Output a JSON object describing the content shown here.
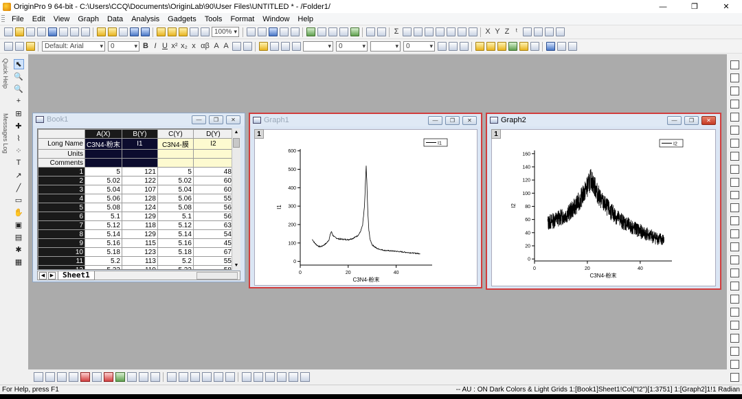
{
  "app": {
    "title": "OriginPro 9 64-bit - C:\\Users\\CCQ\\Documents\\OriginLab\\90\\User Files\\UNTITLED * - /Folder1/",
    "window_controls": {
      "minimize": "—",
      "restore": "❐",
      "close": "✕"
    }
  },
  "menu": [
    "File",
    "Edit",
    "View",
    "Graph",
    "Data",
    "Analysis",
    "Gadgets",
    "Tools",
    "Format",
    "Window",
    "Help"
  ],
  "toolbar": {
    "zoom": "100%",
    "font_name": "Default: Arial",
    "font_size": "0",
    "line_width": "0",
    "line_size2": "0",
    "format_glyphs": [
      "B",
      "I",
      "U",
      "x²",
      "x₂",
      "x",
      "αβ",
      "A",
      "A"
    ],
    "math_glyphs": [
      "Σ",
      "X",
      "Y",
      "Z",
      "ᵗ"
    ]
  },
  "side_tabs": {
    "quick_help": "Quick Help",
    "messages_log": "Messages Log"
  },
  "left_tools": [
    "⬉",
    "🔍",
    "🔍",
    "+",
    "⊞",
    "✚",
    "⌇",
    "⁘",
    "T",
    "↗",
    "╱",
    "▭",
    "✋",
    "▣",
    "▤",
    "✱",
    "▦"
  ],
  "book": {
    "title": "Book1",
    "columns": [
      "A(X)",
      "B(Y)",
      "C(Y)",
      "D(Y)"
    ],
    "row_labels": {
      "long_name": "Long Name",
      "units": "Units",
      "comments": "Comments"
    },
    "long_names": [
      "C3N4-粉末",
      "I1",
      "C3N4-膜",
      "I2"
    ],
    "rows": [
      [
        "1",
        "5",
        "121",
        "5",
        "48"
      ],
      [
        "2",
        "5.02",
        "122",
        "5.02",
        "60"
      ],
      [
        "3",
        "5.04",
        "107",
        "5.04",
        "60"
      ],
      [
        "4",
        "5.06",
        "128",
        "5.06",
        "55"
      ],
      [
        "5",
        "5.08",
        "124",
        "5.08",
        "56"
      ],
      [
        "6",
        "5.1",
        "129",
        "5.1",
        "56"
      ],
      [
        "7",
        "5.12",
        "118",
        "5.12",
        "63"
      ],
      [
        "8",
        "5.14",
        "129",
        "5.14",
        "54"
      ],
      [
        "9",
        "5.16",
        "115",
        "5.16",
        "45"
      ],
      [
        "10",
        "5.18",
        "123",
        "5.18",
        "67"
      ],
      [
        "11",
        "5.2",
        "113",
        "5.2",
        "55"
      ],
      [
        "12",
        "5.22",
        "119",
        "5.22",
        "58"
      ]
    ],
    "sheet_tab": "Sheet1"
  },
  "graph1": {
    "title": "Graph1",
    "layer": "1",
    "legend": "I1",
    "chart_data": {
      "type": "line",
      "xlabel": "C3N4-粉末",
      "ylabel": "I1",
      "xlim": [
        0,
        55
      ],
      "ylim": [
        -20,
        610
      ],
      "xticks": [
        0,
        20,
        40
      ],
      "yticks": [
        0,
        100,
        200,
        300,
        400,
        500,
        600
      ],
      "series": [
        {
          "name": "I1",
          "x": [
            5,
            6,
            7,
            8,
            9,
            10,
            11,
            12,
            12.6,
            13,
            13.6,
            14.5,
            16,
            18,
            20,
            22,
            24,
            25,
            26,
            26.8,
            27.2,
            27.5,
            27.8,
            28.2,
            28.6,
            29.2,
            30,
            32,
            35,
            40,
            45,
            50
          ],
          "y": [
            120,
            100,
            88,
            80,
            82,
            90,
            100,
            118,
            150,
            162,
            142,
            130,
            122,
            120,
            118,
            125,
            140,
            158,
            195,
            300,
            430,
            520,
            420,
            260,
            170,
            115,
            90,
            70,
            60,
            55,
            48,
            42
          ]
        }
      ]
    }
  },
  "graph2": {
    "title": "Graph2",
    "layer": "1",
    "legend": "I2",
    "chart_data": {
      "type": "line",
      "xlabel": "C3N4-粉末",
      "ylabel": "I2",
      "xlim": [
        0,
        52
      ],
      "ylim": [
        -3,
        165
      ],
      "xticks": [
        0,
        20,
        40
      ],
      "yticks": [
        0,
        20,
        40,
        60,
        80,
        100,
        120,
        140,
        160
      ],
      "series": [
        {
          "name": "I2",
          "x": [
            5,
            7,
            9,
            11,
            13,
            15,
            17,
            18,
            19,
            20,
            21,
            21.5,
            22,
            23,
            24,
            26,
            28,
            30,
            33,
            36,
            40,
            44,
            49
          ],
          "y": [
            55,
            58,
            62,
            65,
            70,
            78,
            88,
            95,
            102,
            110,
            118,
            122,
            116,
            108,
            98,
            85,
            76,
            68,
            58,
            50,
            42,
            35,
            28
          ]
        }
      ]
    }
  },
  "status": {
    "left": "For Help, press F1",
    "right": "-- AU : ON  Dark Colors & Light Grids  1:[Book1]Sheet1!Col(\"I2\")[1:3751]  1:[Graph2]1!1  Radian"
  }
}
